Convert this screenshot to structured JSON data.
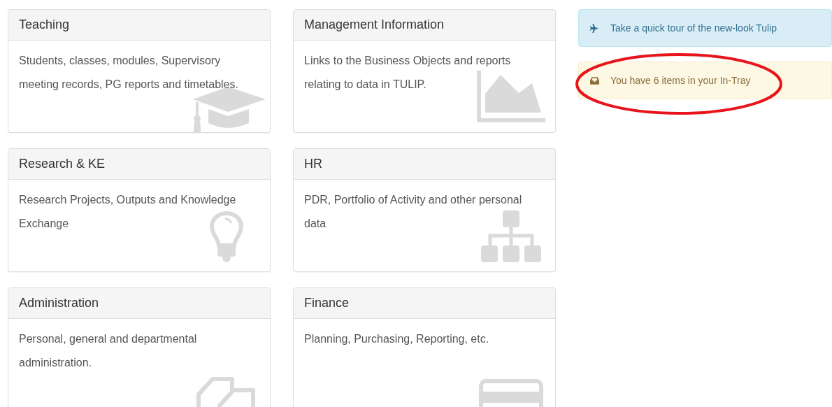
{
  "panels": [
    {
      "title": "Teaching",
      "description": "Students, classes, modules, Supervisory meeting records, PG reports and timetables."
    },
    {
      "title": "Management Information",
      "description": "Links to the Business Objects and reports relating to data in TULIP."
    },
    {
      "title": "Research & KE",
      "description": "Research Projects, Outputs and Knowledge Exchange"
    },
    {
      "title": "HR",
      "description": "PDR, Portfolio of Activity and other personal data"
    },
    {
      "title": "Administration",
      "description": "Personal, general and departmental administration."
    },
    {
      "title": "Finance",
      "description": "Planning, Purchasing, Reporting, etc."
    }
  ],
  "alerts": [
    {
      "kind": "info",
      "text": "Take a quick tour of the new-look Tulip",
      "highlighted": false
    },
    {
      "kind": "warning",
      "text": "You have 6 items in your In-Tray",
      "highlighted": true
    }
  ]
}
